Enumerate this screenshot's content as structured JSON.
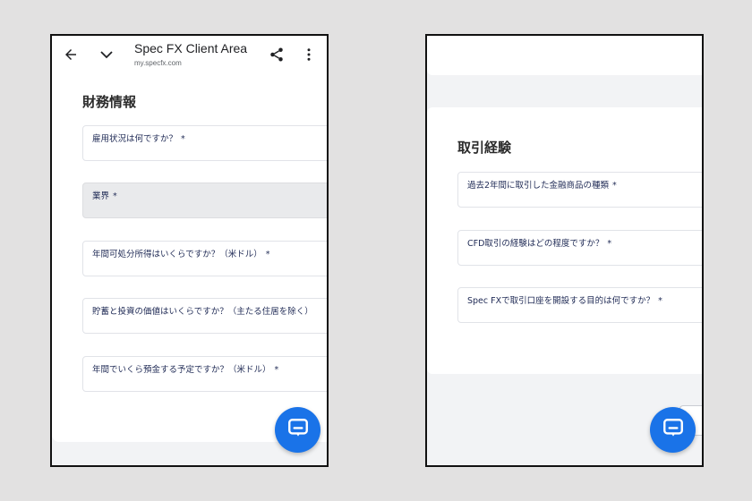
{
  "browser": {
    "title": "Spec FX Client Area",
    "url": "my.specfx.com",
    "back_icon": "arrow-left-icon",
    "collapse_icon": "chevron-down-icon",
    "share_icon": "share-icon",
    "menu_icon": "more-vert-icon"
  },
  "financial_section": {
    "title": "財務情報",
    "fields": [
      {
        "label": "雇用状況は何ですか？",
        "required": "*"
      },
      {
        "label": "業界",
        "required": "*"
      },
      {
        "label": "年間可処分所得はいくらですか？（米ドル）",
        "required": "*"
      },
      {
        "label": "貯蓄と投資の価値はいくらですか？（主たる住居を除く）",
        "required": ""
      },
      {
        "label": "年間でいくら預金する予定ですか？（米ドル）",
        "required": "*"
      }
    ]
  },
  "trading_section": {
    "title": "取引経験",
    "fields": [
      {
        "label": "過去2年間に取引した金融商品の種類",
        "required": "*"
      },
      {
        "label": "CFD取引の経験はどの程度ですか？",
        "required": "*"
      },
      {
        "label": "Spec FXで取引口座を開設する目的は何ですか？",
        "required": "*"
      }
    ]
  },
  "chat": {
    "icon": "chat-bubble-icon"
  },
  "colors": {
    "accent": "#1a73e8",
    "label": "#1f2a55",
    "page_bg": "#e2e1e1"
  }
}
